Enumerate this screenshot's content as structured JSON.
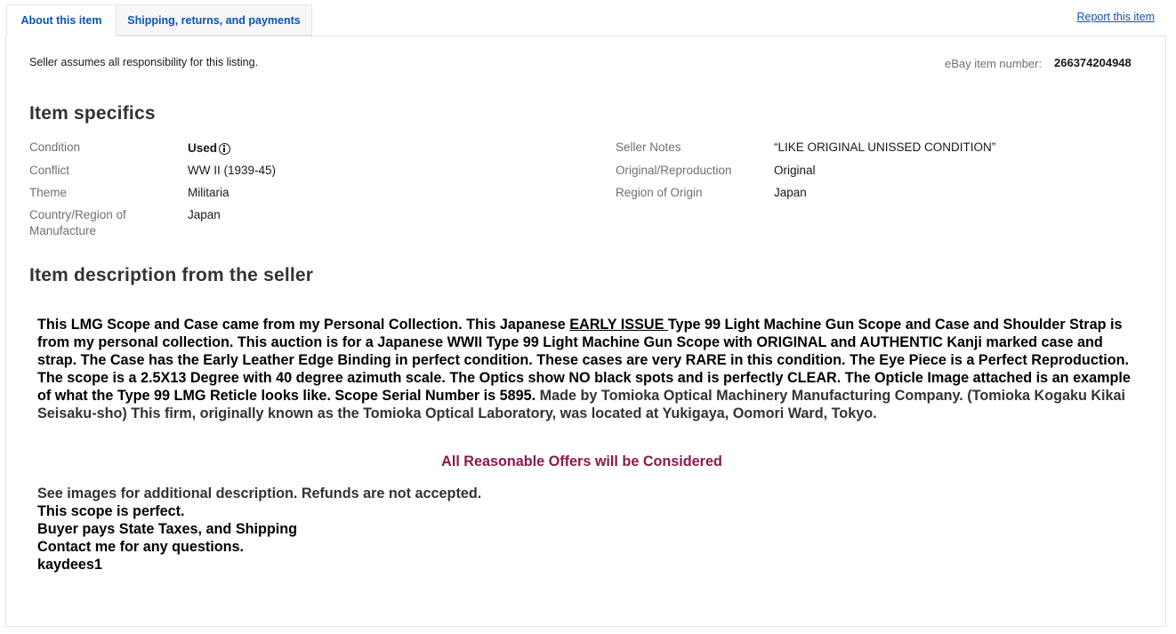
{
  "tabs": {
    "about": "About this item",
    "shipping": "Shipping, returns, and payments"
  },
  "report_link": "Report this item",
  "seller_responsibility": "Seller assumes all responsibility for this listing.",
  "item_number": {
    "label": "eBay item number:",
    "value": "266374204948"
  },
  "item_specifics": {
    "title": "Item specifics",
    "left": [
      {
        "label": "Condition",
        "value": "Used"
      },
      {
        "label": "Conflict",
        "value": "WW II (1939-45)"
      },
      {
        "label": "Theme",
        "value": "Militaria"
      },
      {
        "label": "Country/Region of Manufacture",
        "value": "Japan"
      }
    ],
    "right": [
      {
        "label": "Seller Notes",
        "value": "“LIKE ORIGINAL UNISSED CONDITION”"
      },
      {
        "label": "Original/Reproduction",
        "value": "Original"
      },
      {
        "label": "Region of Origin",
        "value": "Japan"
      }
    ]
  },
  "description": {
    "title": "Item description from the seller",
    "p1_before": "This LMG Scope and Case came from my Personal Collection. This Japanese ",
    "p1_underline": "EARLY ISSUE ",
    "p1_after": "Type 99 Light Machine Gun Scope and Case and Shoulder Strap is from my personal collection. This auction is for a Japanese WWII Type 99 Light Machine Gun Scope with ORIGINAL and AUTHENTIC Kanji marked case and strap. The Case has the Early Leather Edge Binding in perfect condition. These cases are very RARE in this condition. The Eye Piece is a Perfect Reproduction. The scope is a 2.5X13 Degree with 40 degree azimuth scale. The Optics show NO black spots and is perfectly CLEAR. The Opticle Image attached is an example of what the Type 99 LMG Reticle looks like. Scope Serial Number is 5895.",
    "p1_gray": " Made by Tomioka Optical Machinery Manufacturing Company. (Tomioka Kogaku Kikai Seisaku-sho) This firm, originally known as the Tomioka Optical Laboratory, was located at Yukigaya, Oomori Ward, Tokyo.",
    "offer": "All Reasonable Offers will be Considered",
    "lines": [
      "See images for additional description. Refunds are not accepted.",
      "This scope is perfect.",
      "Buyer pays State Taxes, and Shipping",
      "Contact me for any questions.",
      "kaydees1"
    ]
  },
  "colors": {
    "link": "#0654ba",
    "offer": "#8b1a4a",
    "label_gray": "#707070"
  }
}
